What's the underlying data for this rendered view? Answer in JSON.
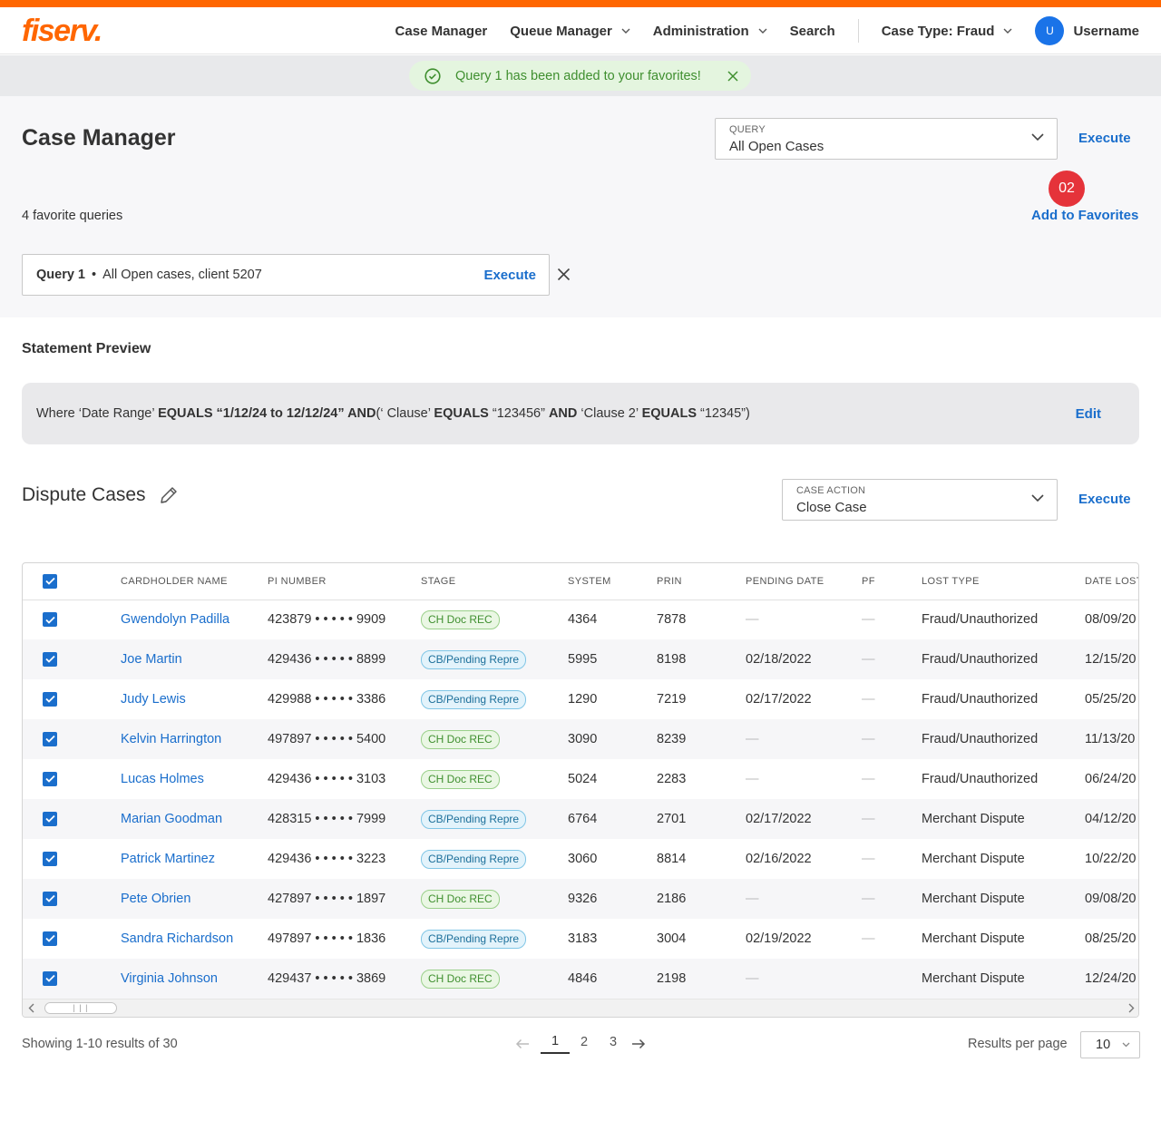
{
  "header": {
    "logo": "fiserv.",
    "nav": [
      {
        "label": "Case Manager",
        "dropdown": false
      },
      {
        "label": "Queue Manager",
        "dropdown": true
      },
      {
        "label": "Administration",
        "dropdown": true
      },
      {
        "label": "Search",
        "dropdown": false
      }
    ],
    "case_type": "Case Type: Fraud",
    "avatar_initial": "U",
    "username": "Username"
  },
  "toast": {
    "message": "Query 1 has been added to your favorites!",
    "icon": "check-circle-icon"
  },
  "page": {
    "title": "Case Manager",
    "query_select": {
      "label": "QUERY",
      "value": "All Open Cases"
    },
    "execute_label": "Execute",
    "badge": "02",
    "add_favorites_label": "Add to Favorites",
    "favorite_count": "4 favorite queries",
    "favorite": {
      "name": "Query 1",
      "separator": "•",
      "description": "All Open cases, client 5207",
      "execute_label": "Execute"
    }
  },
  "statement": {
    "title": "Statement Preview",
    "parts": [
      {
        "t": "Where ‘Date Range’ ",
        "b": false
      },
      {
        "t": "EQUALS",
        "b": true
      },
      {
        "t": " ",
        "b": false
      },
      {
        "t": "“1/12/24 to 12/12/24” AND",
        "b": true
      },
      {
        "t": "(‘ Clause’ ",
        "b": false
      },
      {
        "t": "EQUALS",
        "b": true
      },
      {
        "t": " “123456” ",
        "b": false
      },
      {
        "t": "AND",
        "b": true
      },
      {
        "t": " ‘Clause 2’ ",
        "b": false
      },
      {
        "t": "EQUALS",
        "b": true
      },
      {
        "t": " “12345”)",
        "b": false
      }
    ],
    "edit_label": "Edit"
  },
  "dispute": {
    "title": "Dispute Cases",
    "case_action": {
      "label": "CASE ACTION",
      "value": "Close Case"
    },
    "execute_label": "Execute"
  },
  "table": {
    "columns": [
      "CARDHOLDER NAME",
      "PI NUMBER",
      "STAGE",
      "SYSTEM",
      "PRIN",
      "PENDING DATE",
      "PF",
      "LOST TYPE",
      "DATE LOST"
    ],
    "rows": [
      {
        "name": "Gwendolyn Padilla",
        "pi": "423879 • • • • • 9909",
        "stage": "CH Doc REC",
        "stage_color": "green",
        "system": "4364",
        "prin": "7878",
        "pending": "—",
        "pf": "—",
        "lost_type": "Fraud/Unauthorized",
        "date_lost": "08/09/20"
      },
      {
        "name": "Joe Martin",
        "pi": "429436 • • • • • 8899",
        "stage": "CB/Pending Repre",
        "stage_color": "blue",
        "system": "5995",
        "prin": "8198",
        "pending": "02/18/2022",
        "pf": "—",
        "lost_type": "Fraud/Unauthorized",
        "date_lost": "12/15/20"
      },
      {
        "name": "Judy Lewis",
        "pi": "429988 • • • • • 3386",
        "stage": "CB/Pending Repre",
        "stage_color": "blue",
        "system": "1290",
        "prin": "7219",
        "pending": "02/17/2022",
        "pf": "—",
        "lost_type": "Fraud/Unauthorized",
        "date_lost": "05/25/20"
      },
      {
        "name": "Kelvin Harrington",
        "pi": "497897 • • • • • 5400",
        "stage": "CH Doc REC",
        "stage_color": "green",
        "system": "3090",
        "prin": "8239",
        "pending": "—",
        "pf": "—",
        "lost_type": "Fraud/Unauthorized",
        "date_lost": "11/13/20"
      },
      {
        "name": "Lucas Holmes",
        "pi": "429436 • • • • • 3103",
        "stage": "CH Doc REC",
        "stage_color": "green",
        "system": "5024",
        "prin": "2283",
        "pending": "—",
        "pf": "—",
        "lost_type": "Fraud/Unauthorized",
        "date_lost": "06/24/20"
      },
      {
        "name": "Marian Goodman",
        "pi": "428315 • • • • • 7999",
        "stage": "CB/Pending Repre",
        "stage_color": "blue",
        "system": "6764",
        "prin": "2701",
        "pending": "02/17/2022",
        "pf": "—",
        "lost_type": "Merchant Dispute",
        "date_lost": "04/12/20"
      },
      {
        "name": "Patrick Martinez",
        "pi": "429436 • • • • • 3223",
        "stage": "CB/Pending Repre",
        "stage_color": "blue",
        "system": "3060",
        "prin": "8814",
        "pending": "02/16/2022",
        "pf": "—",
        "lost_type": "Merchant Dispute",
        "date_lost": "10/22/20"
      },
      {
        "name": "Pete Obrien",
        "pi": "427897 • • • • • 1897",
        "stage": "CH Doc REC",
        "stage_color": "green",
        "system": "9326",
        "prin": "2186",
        "pending": "—",
        "pf": "—",
        "lost_type": "Merchant Dispute",
        "date_lost": "09/08/20"
      },
      {
        "name": "Sandra Richardson",
        "pi": "497897 • • • • • 1836",
        "stage": "CB/Pending Repre",
        "stage_color": "blue",
        "system": "3183",
        "prin": "3004",
        "pending": "02/19/2022",
        "pf": "—",
        "lost_type": "Merchant Dispute",
        "date_lost": "08/25/20"
      },
      {
        "name": "Virginia Johnson",
        "pi": "429437 • • • • • 3869",
        "stage": "CH Doc REC",
        "stage_color": "green",
        "system": "4846",
        "prin": "2198",
        "pending": "—",
        "pf": "",
        "lost_type": "Merchant Dispute",
        "date_lost": "12/24/20"
      }
    ]
  },
  "footer": {
    "showing": "Showing 1-10 results of 30",
    "pages": [
      "1",
      "2",
      "3"
    ],
    "current_page": "1",
    "rpp_label": "Results per page",
    "rpp_value": "10"
  },
  "colors": {
    "brand": "#ff6600",
    "link": "#1a6ecc",
    "success": "#3f8f2f",
    "badge": "#e5333a"
  }
}
